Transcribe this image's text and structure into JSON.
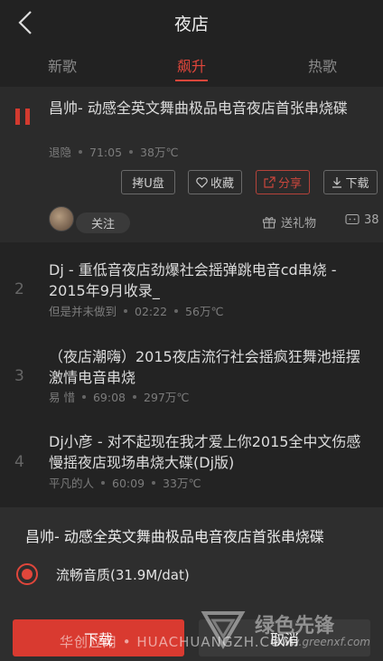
{
  "header": {
    "title": "夜店"
  },
  "tabs": [
    {
      "label": "新歌"
    },
    {
      "label": "飙升"
    },
    {
      "label": "热歌"
    }
  ],
  "songs": [
    {
      "index": "",
      "title": "昌帅- 动感全英文舞曲极品电音夜店首张串烧碟",
      "artist": "退隐",
      "duration": "71:05",
      "temperature": "38万℃"
    },
    {
      "index": "2",
      "title": "Dj - 重低音夜店劲爆社会摇弹跳电音cd串烧 - 2015年9月收录_",
      "artist": "但是并未做到",
      "duration": "02:22",
      "temperature": "56万℃"
    },
    {
      "index": "3",
      "title": "（夜店潮嗨）2015夜店流行社会摇疯狂舞池摇摆激情电音串烧",
      "artist": "易 惜",
      "duration": "69:08",
      "temperature": "297万℃"
    },
    {
      "index": "4",
      "title": "Dj小彦 - 对不起现在我才爱上你2015全中文伤感慢摇夜店现场串烧大碟(Dj版)",
      "artist": "平凡的人",
      "duration": "60:09",
      "temperature": "33万℃"
    }
  ],
  "actions": {
    "copy_usb": "拷U盘",
    "favorite": "收藏",
    "share": "分享",
    "download": "下载",
    "follow": "关注",
    "gift": "送礼物",
    "comment_count": "38"
  },
  "sheet": {
    "title": "昌帅- 动感全英文舞曲极品电音夜店首张串烧碟",
    "quality": "流畅音质(31.9M/dat)",
    "download_button": "下载",
    "cancel_button": "取消"
  },
  "watermark": {
    "left": "华创应用 • HUACHUANGZH.COM",
    "brand": "绿色先锋",
    "url": "www.greenxf.com"
  },
  "colors": {
    "accent": "#e0463b",
    "background": "#1a1a1a"
  }
}
